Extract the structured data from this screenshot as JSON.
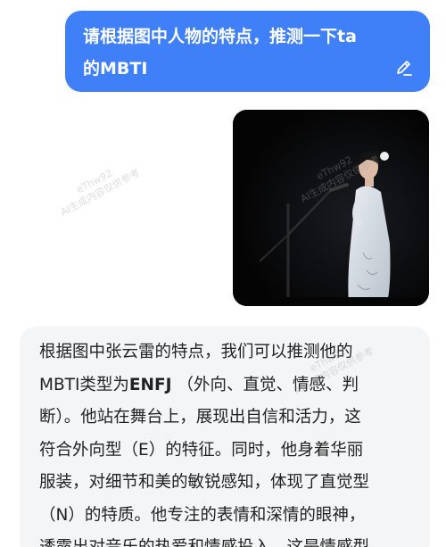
{
  "user_message": {
    "line1": "请根据图中人物的特点，推测一下ta",
    "line2": "的MBTI",
    "edit_icon": "pencil-icon"
  },
  "photo": {
    "watermark_id": "eThw92",
    "watermark_text": "AI生成内容仅供参考"
  },
  "bot_message": {
    "lines": [
      "根据图中张云雷的特点，我们可以推测他的",
      "MBTI类型为",
      "ENFJ",
      "（外向、直觉、情感、判",
      "断）。他站在舞台上，展现出自信和活力，这",
      "符合外向型（E）的特征。同时，他身着华丽",
      "服装，对细节和美的敏锐感知，体现了直觉型",
      "（N）的特质。他专注的表情和深情的眼神，",
      "透露出对音乐的热爱和情感投入，这是情感型"
    ],
    "watermark_id": "eThw92",
    "watermark_text": "AI生成内容仅供参考"
  },
  "colors": {
    "user_bubble": "#3f7ff7",
    "bot_bubble": "#f4f5f7",
    "text": "#222222"
  }
}
